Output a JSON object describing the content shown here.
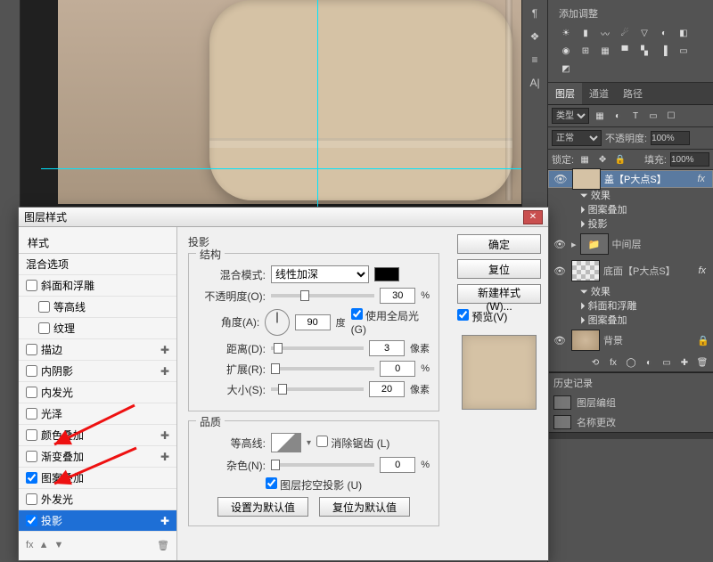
{
  "adjustments_panel": {
    "title": "添加调整"
  },
  "layers_panel": {
    "tabs": [
      "图层",
      "通道",
      "路径"
    ],
    "kind_label": "类型",
    "blend_mode": "正常",
    "opacity_label": "不透明度:",
    "opacity_value": "100%",
    "lock_label": "锁定:",
    "fill_label": "填充:",
    "fill_value": "100%",
    "layers": [
      {
        "name": "盖【P大点S】",
        "fx": "fx",
        "effects_label": "效果",
        "effects": [
          "图案叠加",
          "投影"
        ]
      },
      {
        "name": "中间层",
        "group": true
      },
      {
        "name": "底面【P大点S】",
        "fx": "fx",
        "effects_label": "效果",
        "effects": [
          "斜面和浮雕",
          "图案叠加"
        ]
      },
      {
        "name": "背景",
        "locked": true
      }
    ]
  },
  "history_panel": {
    "title": "历史记录",
    "items": [
      "图层编组",
      "名称更改"
    ]
  },
  "dialog": {
    "title": "图层样式",
    "styles_header": "样式",
    "blend_options": "混合选项",
    "style_items": [
      {
        "label": "斜面和浮雕",
        "checked": false
      },
      {
        "label": "等高线",
        "checked": false,
        "indent": true
      },
      {
        "label": "纹理",
        "checked": false,
        "indent": true
      },
      {
        "label": "描边",
        "checked": false
      },
      {
        "label": "内阴影",
        "checked": false
      },
      {
        "label": "内发光",
        "checked": false
      },
      {
        "label": "光泽",
        "checked": false
      },
      {
        "label": "颜色叠加",
        "checked": false
      },
      {
        "label": "渐变叠加",
        "checked": false
      },
      {
        "label": "图案叠加",
        "checked": true
      },
      {
        "label": "外发光",
        "checked": false
      },
      {
        "label": "投影",
        "checked": true,
        "selected": true
      }
    ],
    "footer_fx": "fx",
    "section_title": "投影",
    "group_structure": "结构",
    "blend_mode_label": "混合模式:",
    "blend_mode_value": "线性加深",
    "opacity_label": "不透明度(O):",
    "opacity_value": "30",
    "percent": "%",
    "angle_label": "角度(A):",
    "angle_value": "90",
    "degree": "度",
    "global_light": "使用全局光 (G)",
    "distance_label": "距离(D):",
    "distance_value": "3",
    "px": "像素",
    "spread_label": "扩展(R):",
    "spread_value": "0",
    "size_label": "大小(S):",
    "size_value": "20",
    "group_quality": "品质",
    "contour_label": "等高线:",
    "antialias": "消除锯齿 (L)",
    "noise_label": "杂色(N):",
    "noise_value": "0",
    "knockout": "图层挖空投影 (U)",
    "make_default": "设置为默认值",
    "reset_default": "复位为默认值",
    "btn_ok": "确定",
    "btn_cancel": "复位",
    "btn_newstyle": "新建样式(W)...",
    "preview_label": "预览(V)"
  }
}
